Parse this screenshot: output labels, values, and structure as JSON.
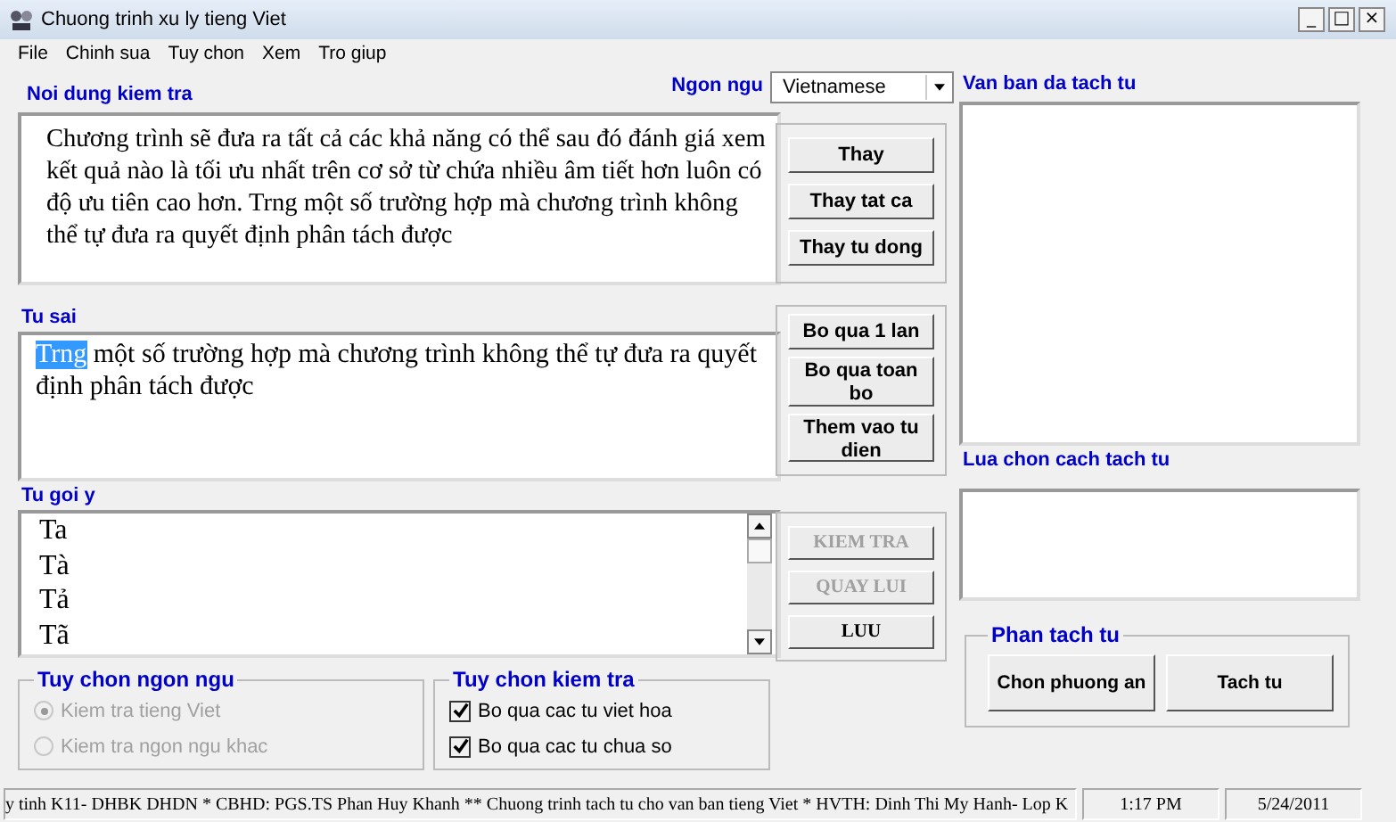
{
  "window": {
    "title": "Chuong trinh xu ly tieng Viet",
    "controls": [
      "_",
      "□",
      "×"
    ]
  },
  "menu": [
    "File",
    "Chinh sua",
    "Tuy chon",
    "Xem",
    "Tro giup"
  ],
  "check_content": {
    "label": "Noi dung kiem tra",
    "text": "Chương trình sẽ đưa ra tất cả các khả năng có thể sau đó đánh giá xem kết quả nào là tối ưu nhất trên cơ sở từ chứa nhiều âm tiết hơn luôn có độ ưu tiên cao hơn. Trng một số trường hợp mà chương trình không thể tự đưa ra quyết định phân tách được"
  },
  "language": {
    "label": "Ngon ngu",
    "value": "Vietnamese"
  },
  "wrong_word": {
    "label": "Tu sai",
    "segments": [
      {
        "text": "Trng",
        "selected": true
      },
      {
        "text": " một số trường hợp mà chương trình không thể tự đưa ra quyết định phân tách được",
        "selected": false
      }
    ]
  },
  "suggestions": {
    "label": "Tu goi y",
    "items": [
      "Ta",
      "Tà",
      "Tả",
      "Tã"
    ]
  },
  "replace_buttons": [
    {
      "label": "Thay",
      "disabled": false
    },
    {
      "label": "Thay tat ca",
      "disabled": false
    },
    {
      "label": "Thay tu dong",
      "disabled": false
    }
  ],
  "ignore_buttons": [
    {
      "label": "Bo qua 1 lan",
      "disabled": false
    },
    {
      "label": "Bo qua toan bo",
      "disabled": false
    },
    {
      "label": "Them vao tu dien",
      "disabled": false
    }
  ],
  "action_buttons": [
    {
      "label": "KIEM TRA",
      "disabled": true
    },
    {
      "label": "QUAY LUI",
      "disabled": true
    },
    {
      "label": "LUU",
      "disabled": false
    }
  ],
  "segmented_text": {
    "label": "Van ban da tach tu"
  },
  "segmentation_choice": {
    "label": "Lua chon cach tach tu"
  },
  "segmentation": {
    "label": "Phan tach tu",
    "buttons": [
      "Chon phuong an",
      "Tach tu"
    ]
  },
  "language_options": {
    "label": "Tuy chon ngon ngu",
    "options": [
      {
        "label": "Kiem tra tieng Viet",
        "selected": true,
        "disabled": true
      },
      {
        "label": "Kiem tra ngon ngu khac",
        "selected": false,
        "disabled": true
      }
    ]
  },
  "check_options": {
    "label": "Tuy chon kiem tra",
    "options": [
      {
        "label": "Bo qua cac tu viet hoa",
        "checked": true
      },
      {
        "label": "Bo qua cac tu chua so",
        "checked": true
      }
    ]
  },
  "status_bar": [
    "y tinh K11- DHBK DHDN * CBHD: PGS.TS Phan Huy Khanh ** Chuong trinh tach tu cho van ban tieng Viet * HVTH: Dinh Thi My Hanh- Lop K",
    "1:17 PM",
    "5/24/2011"
  ]
}
